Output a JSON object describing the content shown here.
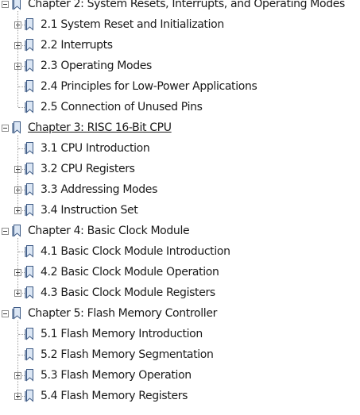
{
  "tree": {
    "chapters": [
      {
        "label": "Chapter 2: System Resets, Interrupts, and Operating Modes",
        "expanded": true,
        "selected": false,
        "children": [
          {
            "label": "2.1 System Reset and Initialization",
            "expandable": true
          },
          {
            "label": "2.2 Interrupts",
            "expandable": true
          },
          {
            "label": "2.3 Operating Modes",
            "expandable": true
          },
          {
            "label": "2.4 Principles for Low-Power Applications",
            "expandable": false
          },
          {
            "label": "2.5 Connection of Unused Pins",
            "expandable": false
          }
        ]
      },
      {
        "label": "Chapter 3: RISC 16-Bit CPU",
        "expanded": true,
        "selected": true,
        "children": [
          {
            "label": "3.1 CPU Introduction",
            "expandable": false
          },
          {
            "label": "3.2 CPU Registers",
            "expandable": true
          },
          {
            "label": "3.3 Addressing Modes",
            "expandable": true
          },
          {
            "label": "3.4 Instruction Set",
            "expandable": true
          }
        ]
      },
      {
        "label": "Chapter 4: Basic Clock Module",
        "expanded": true,
        "selected": false,
        "children": [
          {
            "label": "4.1 Basic Clock Module Introduction",
            "expandable": false
          },
          {
            "label": "4.2 Basic Clock Module Operation",
            "expandable": true
          },
          {
            "label": "4.3 Basic Clock Module Registers",
            "expandable": true
          }
        ]
      },
      {
        "label": "Chapter 5: Flash Memory Controller",
        "expanded": true,
        "selected": false,
        "children": [
          {
            "label": "5.1 Flash Memory Introduction",
            "expandable": false
          },
          {
            "label": "5.2 Flash Memory Segmentation",
            "expandable": false
          },
          {
            "label": "5.3 Flash Memory Operation",
            "expandable": true
          },
          {
            "label": "5.4 Flash Memory Registers",
            "expandable": true
          }
        ]
      }
    ]
  },
  "icons": {
    "expand": "plus-box-icon",
    "collapse": "minus-box-icon",
    "bookmark": "bookmark-icon"
  },
  "colors": {
    "text": "#1a1a1a",
    "icon_stroke": "#3d5a85",
    "icon_fill": "#dbe6f4",
    "guide_line": "#a0a0a0"
  }
}
